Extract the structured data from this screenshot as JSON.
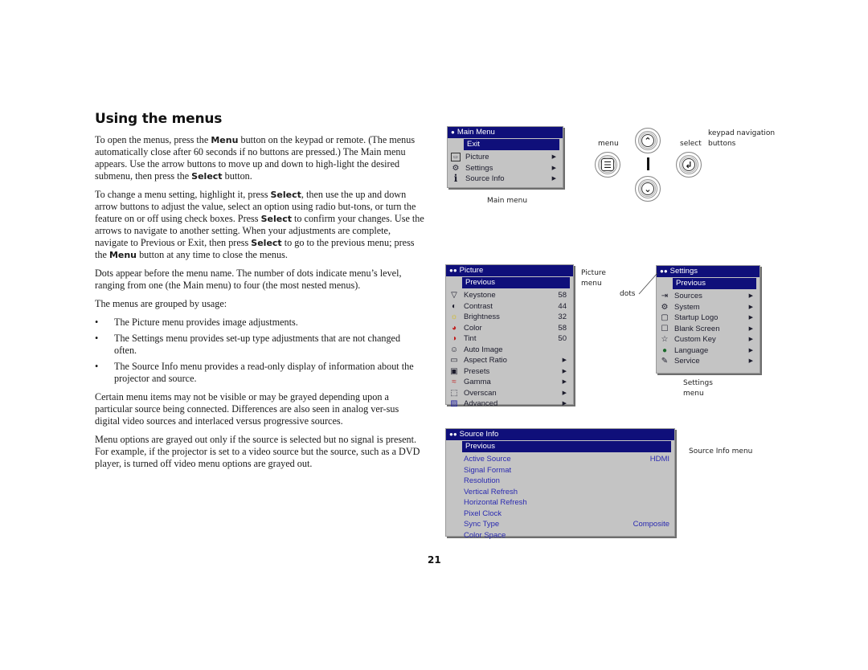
{
  "page": {
    "heading": "Using the menus",
    "page_number": "21"
  },
  "body": {
    "p1": {
      "t1": "To open the menus, press the ",
      "b1": "Menu",
      "t2": " button on the keypad or remote. (The menus automatically close after 60 seconds if no buttons are pressed.) The Main menu appears. Use the arrow buttons to move up and down to high-light the desired submenu, then press the ",
      "b2": "Select",
      "t3": " button."
    },
    "p2": {
      "t1": "To change a menu setting, highlight it, press ",
      "b1": "Select",
      "t2": ", then use the up and down arrow buttons to adjust the value, select an option using radio but-tons, or turn the feature on or off using check boxes. Press ",
      "b2": "Select",
      "t3": " to confirm your changes. Use the arrows to navigate to another setting. When your adjustments are complete, navigate to Previous or Exit, then press ",
      "b3": "Select",
      "t4": " to go to the previous menu; press the ",
      "b4": "Menu",
      "t5": " button at any time to close the menus."
    },
    "p3": "Dots appear before the menu name. The number of dots indicate menu’s level, ranging from one (the Main menu) to four (the most nested menus).",
    "p4": "The menus are grouped by usage:",
    "bullets": [
      "The Picture menu provides image adjustments.",
      "The Settings menu provides set-up type adjustments that are not changed often.",
      "The Source Info menu provides a read-only display of information about the projector and source."
    ],
    "p5": "Certain menu items may not be visible or may be grayed depending upon a particular source being connected. Differences are also seen in analog ver-sus digital video sources and interlaced versus progressive sources.",
    "p6": "Menu options are grayed out only if the source is selected but no signal is present. For example, if the projector is set to a video source but the source, such as a DVD player, is turned off video menu options are grayed out."
  },
  "main_menu": {
    "dots": "●",
    "title": "Main Menu",
    "selected": "Exit",
    "items": [
      {
        "label": "Picture",
        "icon": "abc-picture-icon",
        "glyph": "▭"
      },
      {
        "label": "Settings",
        "icon": "settings-icon",
        "glyph": "⚙"
      },
      {
        "label": "Source Info",
        "icon": "info-icon",
        "glyph": "i"
      }
    ],
    "caption": "Main menu"
  },
  "keypad": {
    "menu_label": "menu",
    "select_label": "select",
    "caption_line1": "keypad navigation",
    "caption_line2": "buttons",
    "up_glyph": "⌃",
    "down_glyph": "⌄",
    "menu_glyph": "☰",
    "select_glyph": "↲"
  },
  "picture_menu": {
    "dots": "●●",
    "title": "Picture",
    "selected": "Previous",
    "items": [
      {
        "label": "Keystone",
        "value": "58",
        "icon": "keystone-icon",
        "glyph": "▽"
      },
      {
        "label": "Contrast",
        "value": "44",
        "icon": "contrast-icon",
        "glyph": "◐"
      },
      {
        "label": "Brightness",
        "value": "32",
        "icon": "brightness-icon",
        "glyph": "☼"
      },
      {
        "label": "Color",
        "value": "58",
        "icon": "color-icon",
        "glyph": "◕"
      },
      {
        "label": "Tint",
        "value": "50",
        "icon": "tint-icon",
        "glyph": "◑"
      },
      {
        "label": "Auto Image",
        "value": "",
        "icon": "auto-image-icon",
        "glyph": "☺"
      },
      {
        "label": "Aspect Ratio",
        "arrow": "▶",
        "icon": "aspect-ratio-icon",
        "glyph": "▭"
      },
      {
        "label": "Presets",
        "arrow": "▶",
        "icon": "presets-icon",
        "glyph": "▣"
      },
      {
        "label": "Gamma",
        "arrow": "▶",
        "icon": "gamma-icon",
        "glyph": "≈"
      },
      {
        "label": "Overscan",
        "arrow": "▶",
        "icon": "overscan-icon",
        "glyph": "⬚"
      },
      {
        "label": "Advanced",
        "arrow": "▶",
        "icon": "advanced-icon",
        "glyph": "▨"
      }
    ],
    "caption_line1": "Picture",
    "caption_line2": "menu",
    "dots_label": "dots"
  },
  "settings_menu": {
    "dots": "●●",
    "title": "Settings",
    "selected": "Previous",
    "items": [
      {
        "label": "Sources",
        "arrow": "▶",
        "icon": "sources-icon",
        "glyph": "⇥"
      },
      {
        "label": "System",
        "arrow": "▶",
        "icon": "system-icon",
        "glyph": "⚙"
      },
      {
        "label": "Startup Logo",
        "arrow": "▶",
        "icon": "startup-logo-icon",
        "glyph": "▢"
      },
      {
        "label": "Blank Screen",
        "arrow": "▶",
        "icon": "blank-screen-icon",
        "glyph": "☐"
      },
      {
        "label": "Custom Key",
        "arrow": "▶",
        "icon": "custom-key-icon",
        "glyph": "☆"
      },
      {
        "label": "Language",
        "arrow": "▶",
        "icon": "language-icon",
        "glyph": "●"
      },
      {
        "label": "Service",
        "arrow": "▶",
        "icon": "service-icon",
        "glyph": "✎"
      }
    ],
    "caption_line1": "Settings",
    "caption_line2": "menu"
  },
  "source_info_menu": {
    "dots": "●●",
    "title": "Source Info",
    "selected": "Previous",
    "items": [
      {
        "label": "Active Source",
        "value": "HDMI"
      },
      {
        "label": "Signal Format",
        "value": ""
      },
      {
        "label": "Resolution",
        "value": ""
      },
      {
        "label": "Vertical Refresh",
        "value": ""
      },
      {
        "label": "Horizontal Refresh",
        "value": ""
      },
      {
        "label": "Pixel Clock",
        "value": ""
      },
      {
        "label": "Sync Type",
        "value": "Composite"
      },
      {
        "label": "Color Space",
        "value": ""
      }
    ],
    "caption": "Source Info menu"
  },
  "colors": {
    "menu_highlight": "#0f0f7a",
    "menu_background": "#c4c4c4",
    "source_info_text": "#2a2ab0"
  }
}
